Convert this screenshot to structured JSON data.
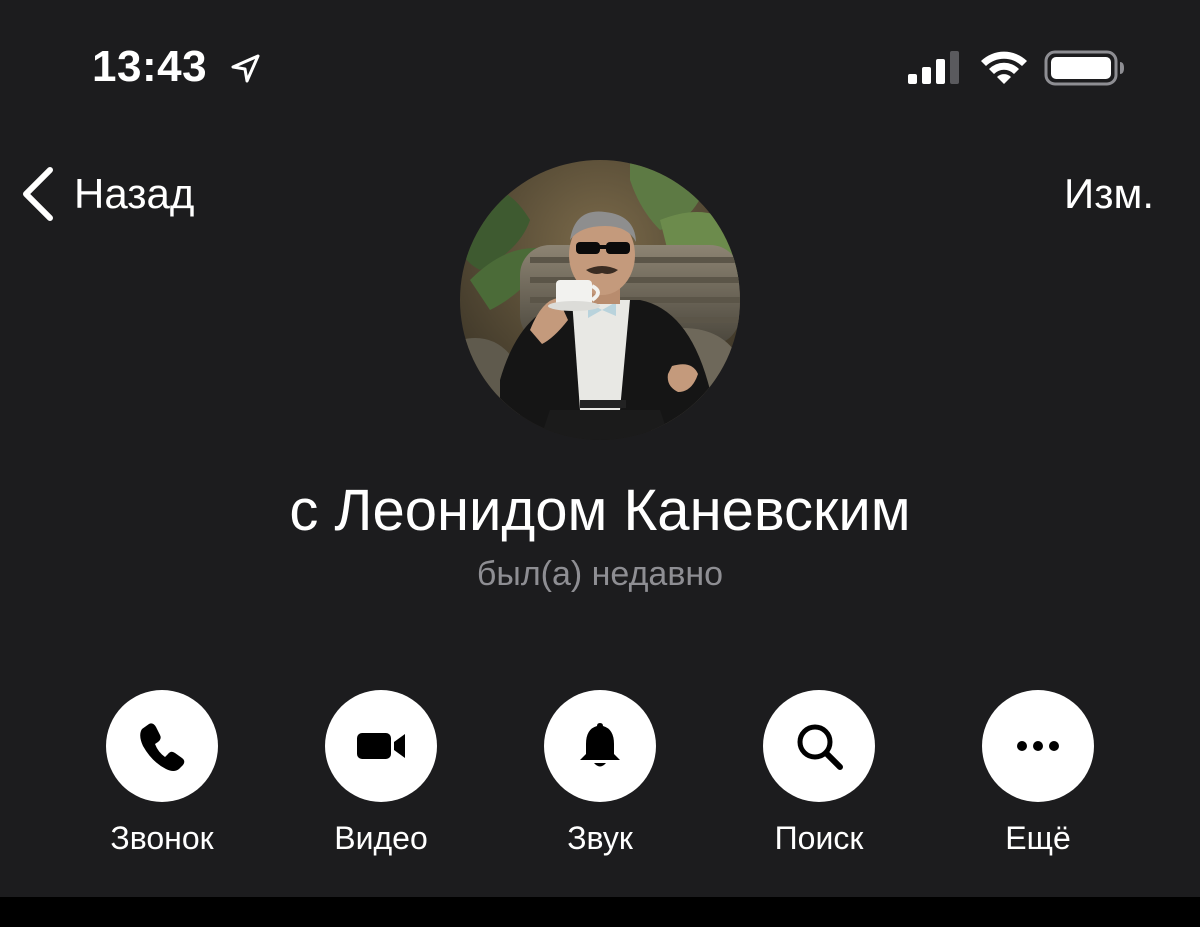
{
  "status_bar": {
    "time": "13:43",
    "icons": [
      "location-arrow-icon",
      "signal-icon",
      "wifi-icon",
      "battery-icon"
    ]
  },
  "nav": {
    "back_label": "Назад",
    "edit_label": "Изм."
  },
  "profile": {
    "name": "с Леонидом Каневским",
    "status": "был(а) недавно"
  },
  "actions": [
    {
      "label": "Звонок",
      "icon": "phone-icon"
    },
    {
      "label": "Видео",
      "icon": "video-icon"
    },
    {
      "label": "Звук",
      "icon": "bell-icon"
    },
    {
      "label": "Поиск",
      "icon": "search-icon"
    },
    {
      "label": "Ещё",
      "icon": "more-icon"
    }
  ],
  "colors": {
    "background": "#1c1c1e",
    "text": "#ffffff",
    "secondary_text": "#8e8e93",
    "button_fill": "#ffffff",
    "icon_fill": "#000000"
  }
}
